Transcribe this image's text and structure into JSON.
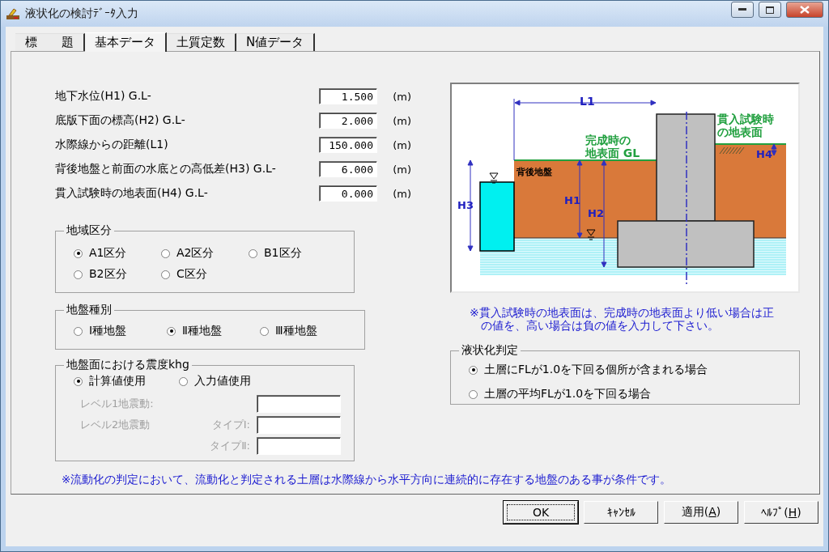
{
  "window": {
    "title": "液状化の検討ﾃﾞｰﾀ入力"
  },
  "tabs": [
    {
      "label": "標　　題",
      "selected": false
    },
    {
      "label": "基本データ",
      "selected": true
    },
    {
      "label": "土質定数",
      "selected": false
    },
    {
      "label": "N値データ",
      "selected": false
    }
  ],
  "fields": [
    {
      "label": "地下水位(H1)  G.L-",
      "value": "1.500",
      "unit": "(m)"
    },
    {
      "label": "底版下面の標高(H2) G.L-",
      "value": "2.000",
      "unit": "(m)"
    },
    {
      "label": "水際線からの距離(L1)",
      "value": "150.000",
      "unit": "(m)"
    },
    {
      "label": "背後地盤と前面の水底との高低差(H3) G.L-",
      "value": "6.000",
      "unit": "(m)"
    },
    {
      "label": "貫入試験時の地表面(H4) G.L-",
      "value": "0.000",
      "unit": "(m)"
    }
  ],
  "region_group": {
    "title": "地域区分",
    "options": [
      {
        "label": "A1区分",
        "selected": true
      },
      {
        "label": "A2区分",
        "selected": false
      },
      {
        "label": "B1区分",
        "selected": false
      },
      {
        "label": "B2区分",
        "selected": false
      },
      {
        "label": "C区分",
        "selected": false
      }
    ]
  },
  "ground_type_group": {
    "title": "地盤種別",
    "options": [
      {
        "label": "Ⅰ種地盤",
        "selected": false
      },
      {
        "label": "Ⅱ種地盤",
        "selected": true
      },
      {
        "label": "Ⅲ種地盤",
        "selected": false
      }
    ]
  },
  "seismic_group": {
    "title": "地盤面における震度khg",
    "options": [
      {
        "label": "計算値使用",
        "selected": true
      },
      {
        "label": "入力値使用",
        "selected": false
      }
    ],
    "inputs": [
      {
        "label": "レベル1地震動:",
        "disabled": true
      },
      {
        "label": "レベル2地震動",
        "type_label": "タイプⅠ:",
        "disabled": true
      },
      {
        "type_label": "タイプⅡ:",
        "disabled": true
      }
    ]
  },
  "diagram": {
    "labels": [
      {
        "lines": [
          "L1"
        ]
      },
      {
        "lines": [
          "完成時の",
          "地表面 GL"
        ]
      },
      {
        "lines": [
          "貫入試験時",
          "の地表面"
        ]
      },
      {
        "lines": [
          "H4"
        ]
      },
      {
        "lines": [
          "背後地盤"
        ]
      },
      {
        "lines": [
          "H3"
        ]
      },
      {
        "lines": [
          "H1"
        ]
      },
      {
        "lines": [
          "H2"
        ]
      }
    ]
  },
  "diagram_note": "※貫入試験時の地表面は、完成時の地表面より低い場合は正の値を、高い場合は負の値を入力して下さい。",
  "judgement_group": {
    "title": "液状化判定",
    "options": [
      {
        "label": "土層にFLが1.0を下回る個所が含まれる場合",
        "selected": true
      },
      {
        "label": "土層の平均FLが1.0を下回る場合",
        "selected": false
      }
    ]
  },
  "footer_note": "※流動化の判定において、流動化と判定される土層は水際線から水平方向に連続的に存在する地盤のある事が条件です。",
  "buttons": [
    {
      "label": "OK",
      "focused": true
    },
    {
      "label": "ｷｬﾝｾﾙ",
      "focused": false
    },
    {
      "label": "適用(",
      "mnemonic": "A",
      "suffix": ")",
      "focused": false
    },
    {
      "label": "ﾍﾙﾌﾟ(",
      "mnemonic": "H",
      "suffix": ")",
      "focused": false
    }
  ]
}
